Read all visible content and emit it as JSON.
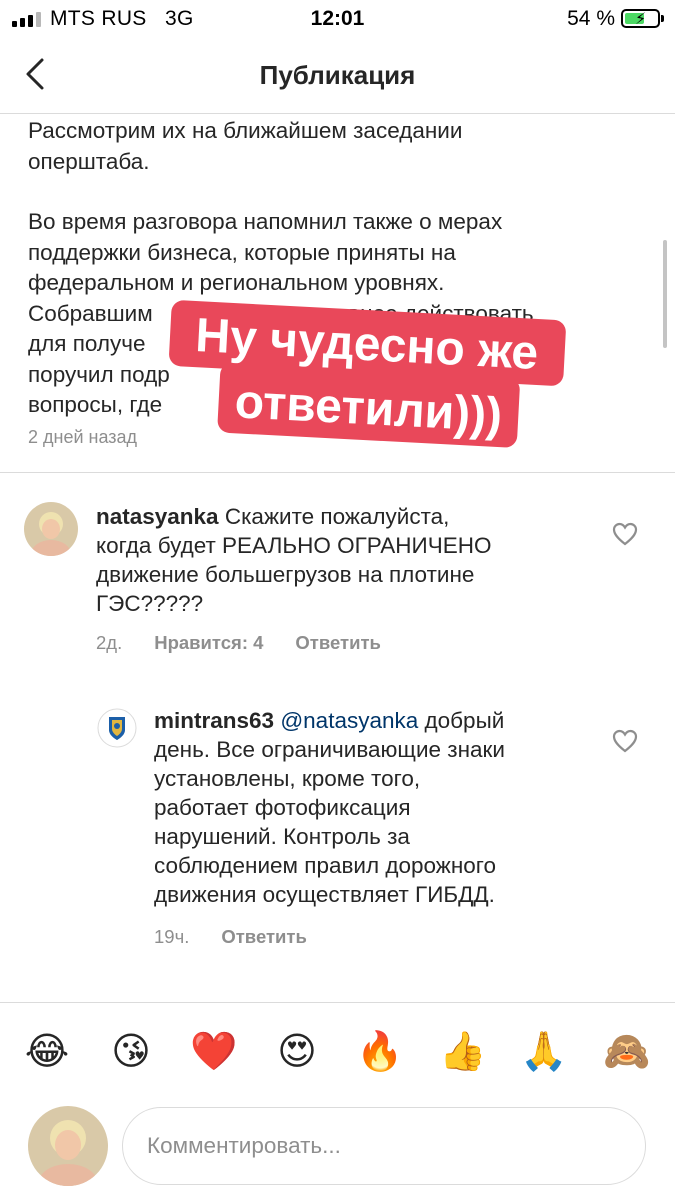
{
  "status_bar": {
    "carrier": "MTS RUS",
    "network": "3G",
    "time": "12:01",
    "battery": "54 %",
    "battery_level": 0.54
  },
  "header": {
    "title": "Публикация"
  },
  "caption": {
    "paragraphs": [
      "Рассмотрим их на ближайшем заседании оперштаба.",
      "Во время разговора напомнил также о мерах поддержки бизнеса, которые приняты на федеральном и региональном уровнях. Собравшим... активнее действовать для получе... ...там поручил подр... ...ые вопросы, где ... ...ддержка."
    ],
    "lines": [
      "Рассмотрим их на ближайшем заседании",
      "оперштаба.",
      "Во время разговора напомнил также о мерах",
      "поддержки бизнеса, которые приняты на",
      "федеральном и региональном уровнях.",
      "Собравшим                        активнее действовать",
      "для получе                                              там",
      "поручил подр                                             ые",
      "вопросы, где                                       ддержка."
    ],
    "time": "2 дней назад"
  },
  "sticker": {
    "line1": "Ну чудесно же",
    "line2": "ответили)))",
    "color": "#e9485a"
  },
  "comments": [
    {
      "username": "natasyanka",
      "text": "Скажите пожалуйста, когда будет РЕАЛЬНО ОГРАНИЧЕНО движение большегрузов на плотине ГЭС?????",
      "line1_rest": "Скажите пожалуйста,",
      "line2": "когда будет РЕАЛЬНО ОГРАНИЧЕНО",
      "line3": "движение большегрузов на плотине",
      "line4": "ГЭС?????",
      "time": "2д.",
      "likes": "Нравится: 4",
      "reply": "Ответить"
    },
    {
      "username": "mintrans63",
      "mention": "@natasyanka",
      "line1_rest": "добрый",
      "line2": "день. Все ограничивающие знаки",
      "line3": "установлены, кроме того,",
      "line4": "работает фотофиксация",
      "line5": "нарушений. Контроль за",
      "line6": "соблюдением правил дорожного",
      "line7": "движения осуществляет ГИБДД.",
      "time": "19ч.",
      "reply": "Ответить"
    }
  ],
  "emoji_bar": [
    "😂",
    "😘",
    "❤️",
    "😍",
    "🔥",
    "👍",
    "🙏",
    "🙈"
  ],
  "emoji_names": [
    "tears-of-joy",
    "kiss",
    "red-heart",
    "heart-eyes",
    "fire",
    "thumbs-up",
    "folded-hands",
    "see-no-evil-monkey"
  ],
  "comment_input": {
    "placeholder": "Комментировать..."
  },
  "colors": {
    "text": "#262626",
    "secondary": "#8e8e8e",
    "mention": "#003569",
    "divider": "#dbdbdb",
    "battery": "#4cd964"
  }
}
